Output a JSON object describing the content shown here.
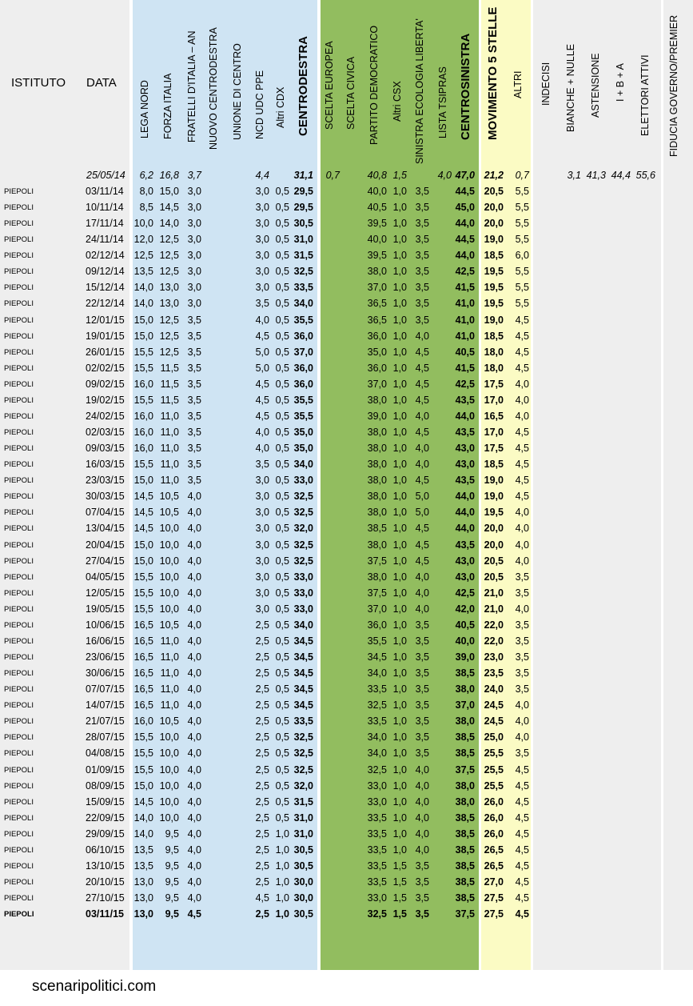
{
  "colors": {
    "grey_bg": "#eeeeee",
    "cdx_bg": "#cfe4f3",
    "csx_bg": "#92bd5f",
    "m5s_bg": "#fbfbc4",
    "white_gap": "#ffffff"
  },
  "headers": {
    "istituto": "ISTITUTO",
    "data": "DATA",
    "columns": [
      "LEGA NORD",
      "FORZA ITALIA",
      "FRATELLI D'ITALIA – AN",
      "NUOVO CENTRODESTRA",
      "UNIONE DI CENTRO",
      "NCD UDC PPE",
      "Altri CDX",
      "CENTRODESTRA",
      "SCELTA EUROPEA",
      "SCELTA CIVICA",
      "PARTITO DEMOCRATICO",
      "Altri CSX",
      "SINISTRA ECOLOGIA LIBERTA'",
      "LISTA TSIPRAS",
      "CENTROSINISTRA",
      "MOVIMENTO 5 STELLE",
      "ALTRI",
      "INDECISI",
      "BIANCHE + NULLE",
      "ASTENSIONE",
      "I + B + A",
      "ELETTORI ATTIVI",
      "FIDUCIA GOVERNO/PREMIER"
    ]
  },
  "reference_row": {
    "date": "25/05/14",
    "values": [
      "6,2",
      "16,8",
      "3,7",
      "",
      "",
      "4,4",
      "",
      "31,1",
      "0,7",
      "",
      "40,8",
      "1,5",
      "",
      "4,0",
      "47,0",
      "21,2",
      "0,7",
      "",
      "3,1",
      "41,3",
      "44,4",
      "55,6",
      ""
    ]
  },
  "rows": [
    {
      "istituto": "PIEPOLI",
      "date": "03/11/14",
      "lega": "8,0",
      "fi": "15,0",
      "fdi": "3,0",
      "ncd": "3,0",
      "acdx": "0,5",
      "cdx": "29,5",
      "pd": "40,0",
      "acsx": "1,0",
      "sel": "3,5",
      "csx": "44,5",
      "m5s": "20,5",
      "altri": "5,5"
    },
    {
      "istituto": "PIEPOLI",
      "date": "10/11/14",
      "lega": "8,5",
      "fi": "14,5",
      "fdi": "3,0",
      "ncd": "3,0",
      "acdx": "0,5",
      "cdx": "29,5",
      "pd": "40,5",
      "acsx": "1,0",
      "sel": "3,5",
      "csx": "45,0",
      "m5s": "20,0",
      "altri": "5,5"
    },
    {
      "istituto": "PIEPOLI",
      "date": "17/11/14",
      "lega": "10,0",
      "fi": "14,0",
      "fdi": "3,0",
      "ncd": "3,0",
      "acdx": "0,5",
      "cdx": "30,5",
      "pd": "39,5",
      "acsx": "1,0",
      "sel": "3,5",
      "csx": "44,0",
      "m5s": "20,0",
      "altri": "5,5"
    },
    {
      "istituto": "PIEPOLI",
      "date": "24/11/14",
      "lega": "12,0",
      "fi": "12,5",
      "fdi": "3,0",
      "ncd": "3,0",
      "acdx": "0,5",
      "cdx": "31,0",
      "pd": "40,0",
      "acsx": "1,0",
      "sel": "3,5",
      "csx": "44,5",
      "m5s": "19,0",
      "altri": "5,5"
    },
    {
      "istituto": "PIEPOLI",
      "date": "02/12/14",
      "lega": "12,5",
      "fi": "12,5",
      "fdi": "3,0",
      "ncd": "3,0",
      "acdx": "0,5",
      "cdx": "31,5",
      "pd": "39,5",
      "acsx": "1,0",
      "sel": "3,5",
      "csx": "44,0",
      "m5s": "18,5",
      "altri": "6,0"
    },
    {
      "istituto": "PIEPOLI",
      "date": "09/12/14",
      "lega": "13,5",
      "fi": "12,5",
      "fdi": "3,0",
      "ncd": "3,0",
      "acdx": "0,5",
      "cdx": "32,5",
      "pd": "38,0",
      "acsx": "1,0",
      "sel": "3,5",
      "csx": "42,5",
      "m5s": "19,5",
      "altri": "5,5"
    },
    {
      "istituto": "PIEPOLI",
      "date": "15/12/14",
      "lega": "14,0",
      "fi": "13,0",
      "fdi": "3,0",
      "ncd": "3,0",
      "acdx": "0,5",
      "cdx": "33,5",
      "pd": "37,0",
      "acsx": "1,0",
      "sel": "3,5",
      "csx": "41,5",
      "m5s": "19,5",
      "altri": "5,5"
    },
    {
      "istituto": "PIEPOLI",
      "date": "22/12/14",
      "lega": "14,0",
      "fi": "13,0",
      "fdi": "3,0",
      "ncd": "3,5",
      "acdx": "0,5",
      "cdx": "34,0",
      "pd": "36,5",
      "acsx": "1,0",
      "sel": "3,5",
      "csx": "41,0",
      "m5s": "19,5",
      "altri": "5,5"
    },
    {
      "istituto": "PIEPOLI",
      "date": "12/01/15",
      "lega": "15,0",
      "fi": "12,5",
      "fdi": "3,5",
      "ncd": "4,0",
      "acdx": "0,5",
      "cdx": "35,5",
      "pd": "36,5",
      "acsx": "1,0",
      "sel": "3,5",
      "csx": "41,0",
      "m5s": "19,0",
      "altri": "4,5"
    },
    {
      "istituto": "PIEPOLI",
      "date": "19/01/15",
      "lega": "15,0",
      "fi": "12,5",
      "fdi": "3,5",
      "ncd": "4,5",
      "acdx": "0,5",
      "cdx": "36,0",
      "pd": "36,0",
      "acsx": "1,0",
      "sel": "4,0",
      "csx": "41,0",
      "m5s": "18,5",
      "altri": "4,5"
    },
    {
      "istituto": "PIEPOLI",
      "date": "26/01/15",
      "lega": "15,5",
      "fi": "12,5",
      "fdi": "3,5",
      "ncd": "5,0",
      "acdx": "0,5",
      "cdx": "37,0",
      "pd": "35,0",
      "acsx": "1,0",
      "sel": "4,5",
      "csx": "40,5",
      "m5s": "18,0",
      "altri": "4,5"
    },
    {
      "istituto": "PIEPOLI",
      "date": "02/02/15",
      "lega": "15,5",
      "fi": "11,5",
      "fdi": "3,5",
      "ncd": "5,0",
      "acdx": "0,5",
      "cdx": "36,0",
      "pd": "36,0",
      "acsx": "1,0",
      "sel": "4,5",
      "csx": "41,5",
      "m5s": "18,0",
      "altri": "4,5"
    },
    {
      "istituto": "PIEPOLI",
      "date": "09/02/15",
      "lega": "16,0",
      "fi": "11,5",
      "fdi": "3,5",
      "ncd": "4,5",
      "acdx": "0,5",
      "cdx": "36,0",
      "pd": "37,0",
      "acsx": "1,0",
      "sel": "4,5",
      "csx": "42,5",
      "m5s": "17,5",
      "altri": "4,0"
    },
    {
      "istituto": "PIEPOLI",
      "date": "19/02/15",
      "lega": "15,5",
      "fi": "11,5",
      "fdi": "3,5",
      "ncd": "4,5",
      "acdx": "0,5",
      "cdx": "35,5",
      "pd": "38,0",
      "acsx": "1,0",
      "sel": "4,5",
      "csx": "43,5",
      "m5s": "17,0",
      "altri": "4,0"
    },
    {
      "istituto": "PIEPOLI",
      "date": "24/02/15",
      "lega": "16,0",
      "fi": "11,0",
      "fdi": "3,5",
      "ncd": "4,5",
      "acdx": "0,5",
      "cdx": "35,5",
      "pd": "39,0",
      "acsx": "1,0",
      "sel": "4,0",
      "csx": "44,0",
      "m5s": "16,5",
      "altri": "4,0"
    },
    {
      "istituto": "PIEPOLI",
      "date": "02/03/15",
      "lega": "16,0",
      "fi": "11,0",
      "fdi": "3,5",
      "ncd": "4,0",
      "acdx": "0,5",
      "cdx": "35,0",
      "pd": "38,0",
      "acsx": "1,0",
      "sel": "4,5",
      "csx": "43,5",
      "m5s": "17,0",
      "altri": "4,5"
    },
    {
      "istituto": "PIEPOLI",
      "date": "09/03/15",
      "lega": "16,0",
      "fi": "11,0",
      "fdi": "3,5",
      "ncd": "4,0",
      "acdx": "0,5",
      "cdx": "35,0",
      "pd": "38,0",
      "acsx": "1,0",
      "sel": "4,0",
      "csx": "43,0",
      "m5s": "17,5",
      "altri": "4,5"
    },
    {
      "istituto": "PIEPOLI",
      "date": "16/03/15",
      "lega": "15,5",
      "fi": "11,0",
      "fdi": "3,5",
      "ncd": "3,5",
      "acdx": "0,5",
      "cdx": "34,0",
      "pd": "38,0",
      "acsx": "1,0",
      "sel": "4,0",
      "csx": "43,0",
      "m5s": "18,5",
      "altri": "4,5"
    },
    {
      "istituto": "PIEPOLI",
      "date": "23/03/15",
      "lega": "15,0",
      "fi": "11,0",
      "fdi": "3,5",
      "ncd": "3,0",
      "acdx": "0,5",
      "cdx": "33,0",
      "pd": "38,0",
      "acsx": "1,0",
      "sel": "4,5",
      "csx": "43,5",
      "m5s": "19,0",
      "altri": "4,5"
    },
    {
      "istituto": "PIEPOLI",
      "date": "30/03/15",
      "lega": "14,5",
      "fi": "10,5",
      "fdi": "4,0",
      "ncd": "3,0",
      "acdx": "0,5",
      "cdx": "32,5",
      "pd": "38,0",
      "acsx": "1,0",
      "sel": "5,0",
      "csx": "44,0",
      "m5s": "19,0",
      "altri": "4,5"
    },
    {
      "istituto": "PIEPOLI",
      "date": "07/04/15",
      "lega": "14,5",
      "fi": "10,5",
      "fdi": "4,0",
      "ncd": "3,0",
      "acdx": "0,5",
      "cdx": "32,5",
      "pd": "38,0",
      "acsx": "1,0",
      "sel": "5,0",
      "csx": "44,0",
      "m5s": "19,5",
      "altri": "4,0"
    },
    {
      "istituto": "PIEPOLI",
      "date": "13/04/15",
      "lega": "14,5",
      "fi": "10,0",
      "fdi": "4,0",
      "ncd": "3,0",
      "acdx": "0,5",
      "cdx": "32,0",
      "pd": "38,5",
      "acsx": "1,0",
      "sel": "4,5",
      "csx": "44,0",
      "m5s": "20,0",
      "altri": "4,0"
    },
    {
      "istituto": "PIEPOLI",
      "date": "20/04/15",
      "lega": "15,0",
      "fi": "10,0",
      "fdi": "4,0",
      "ncd": "3,0",
      "acdx": "0,5",
      "cdx": "32,5",
      "pd": "38,0",
      "acsx": "1,0",
      "sel": "4,5",
      "csx": "43,5",
      "m5s": "20,0",
      "altri": "4,0"
    },
    {
      "istituto": "PIEPOLI",
      "date": "27/04/15",
      "lega": "15,0",
      "fi": "10,0",
      "fdi": "4,0",
      "ncd": "3,0",
      "acdx": "0,5",
      "cdx": "32,5",
      "pd": "37,5",
      "acsx": "1,0",
      "sel": "4,5",
      "csx": "43,0",
      "m5s": "20,5",
      "altri": "4,0"
    },
    {
      "istituto": "PIEPOLI",
      "date": "04/05/15",
      "lega": "15,5",
      "fi": "10,0",
      "fdi": "4,0",
      "ncd": "3,0",
      "acdx": "0,5",
      "cdx": "33,0",
      "pd": "38,0",
      "acsx": "1,0",
      "sel": "4,0",
      "csx": "43,0",
      "m5s": "20,5",
      "altri": "3,5"
    },
    {
      "istituto": "PIEPOLI",
      "date": "12/05/15",
      "lega": "15,5",
      "fi": "10,0",
      "fdi": "4,0",
      "ncd": "3,0",
      "acdx": "0,5",
      "cdx": "33,0",
      "pd": "37,5",
      "acsx": "1,0",
      "sel": "4,0",
      "csx": "42,5",
      "m5s": "21,0",
      "altri": "3,5"
    },
    {
      "istituto": "PIEPOLI",
      "date": "19/05/15",
      "lega": "15,5",
      "fi": "10,0",
      "fdi": "4,0",
      "ncd": "3,0",
      "acdx": "0,5",
      "cdx": "33,0",
      "pd": "37,0",
      "acsx": "1,0",
      "sel": "4,0",
      "csx": "42,0",
      "m5s": "21,0",
      "altri": "4,0"
    },
    {
      "istituto": "PIEPOLI",
      "date": "10/06/15",
      "lega": "16,5",
      "fi": "10,5",
      "fdi": "4,0",
      "ncd": "2,5",
      "acdx": "0,5",
      "cdx": "34,0",
      "pd": "36,0",
      "acsx": "1,0",
      "sel": "3,5",
      "csx": "40,5",
      "m5s": "22,0",
      "altri": "3,5"
    },
    {
      "istituto": "PIEPOLI",
      "date": "16/06/15",
      "lega": "16,5",
      "fi": "11,0",
      "fdi": "4,0",
      "ncd": "2,5",
      "acdx": "0,5",
      "cdx": "34,5",
      "pd": "35,5",
      "acsx": "1,0",
      "sel": "3,5",
      "csx": "40,0",
      "m5s": "22,0",
      "altri": "3,5"
    },
    {
      "istituto": "PIEPOLI",
      "date": "23/06/15",
      "lega": "16,5",
      "fi": "11,0",
      "fdi": "4,0",
      "ncd": "2,5",
      "acdx": "0,5",
      "cdx": "34,5",
      "pd": "34,5",
      "acsx": "1,0",
      "sel": "3,5",
      "csx": "39,0",
      "m5s": "23,0",
      "altri": "3,5"
    },
    {
      "istituto": "PIEPOLI",
      "date": "30/06/15",
      "lega": "16,5",
      "fi": "11,0",
      "fdi": "4,0",
      "ncd": "2,5",
      "acdx": "0,5",
      "cdx": "34,5",
      "pd": "34,0",
      "acsx": "1,0",
      "sel": "3,5",
      "csx": "38,5",
      "m5s": "23,5",
      "altri": "3,5"
    },
    {
      "istituto": "PIEPOLI",
      "date": "07/07/15",
      "lega": "16,5",
      "fi": "11,0",
      "fdi": "4,0",
      "ncd": "2,5",
      "acdx": "0,5",
      "cdx": "34,5",
      "pd": "33,5",
      "acsx": "1,0",
      "sel": "3,5",
      "csx": "38,0",
      "m5s": "24,0",
      "altri": "3,5"
    },
    {
      "istituto": "PIEPOLI",
      "date": "14/07/15",
      "lega": "16,5",
      "fi": "11,0",
      "fdi": "4,0",
      "ncd": "2,5",
      "acdx": "0,5",
      "cdx": "34,5",
      "pd": "32,5",
      "acsx": "1,0",
      "sel": "3,5",
      "csx": "37,0",
      "m5s": "24,5",
      "altri": "4,0"
    },
    {
      "istituto": "PIEPOLI",
      "date": "21/07/15",
      "lega": "16,0",
      "fi": "10,5",
      "fdi": "4,0",
      "ncd": "2,5",
      "acdx": "0,5",
      "cdx": "33,5",
      "pd": "33,5",
      "acsx": "1,0",
      "sel": "3,5",
      "csx": "38,0",
      "m5s": "24,5",
      "altri": "4,0"
    },
    {
      "istituto": "PIEPOLI",
      "date": "28/07/15",
      "lega": "15,5",
      "fi": "10,0",
      "fdi": "4,0",
      "ncd": "2,5",
      "acdx": "0,5",
      "cdx": "32,5",
      "pd": "34,0",
      "acsx": "1,0",
      "sel": "3,5",
      "csx": "38,5",
      "m5s": "25,0",
      "altri": "4,0"
    },
    {
      "istituto": "PIEPOLI",
      "date": "04/08/15",
      "lega": "15,5",
      "fi": "10,0",
      "fdi": "4,0",
      "ncd": "2,5",
      "acdx": "0,5",
      "cdx": "32,5",
      "pd": "34,0",
      "acsx": "1,0",
      "sel": "3,5",
      "csx": "38,5",
      "m5s": "25,5",
      "altri": "3,5"
    },
    {
      "istituto": "PIEPOLI",
      "date": "01/09/15",
      "lega": "15,5",
      "fi": "10,0",
      "fdi": "4,0",
      "ncd": "2,5",
      "acdx": "0,5",
      "cdx": "32,5",
      "pd": "32,5",
      "acsx": "1,0",
      "sel": "4,0",
      "csx": "37,5",
      "m5s": "25,5",
      "altri": "4,5"
    },
    {
      "istituto": "PIEPOLI",
      "date": "08/09/15",
      "lega": "15,0",
      "fi": "10,0",
      "fdi": "4,0",
      "ncd": "2,5",
      "acdx": "0,5",
      "cdx": "32,0",
      "pd": "33,0",
      "acsx": "1,0",
      "sel": "4,0",
      "csx": "38,0",
      "m5s": "25,5",
      "altri": "4,5"
    },
    {
      "istituto": "PIEPOLI",
      "date": "15/09/15",
      "lega": "14,5",
      "fi": "10,0",
      "fdi": "4,0",
      "ncd": "2,5",
      "acdx": "0,5",
      "cdx": "31,5",
      "pd": "33,0",
      "acsx": "1,0",
      "sel": "4,0",
      "csx": "38,0",
      "m5s": "26,0",
      "altri": "4,5"
    },
    {
      "istituto": "PIEPOLI",
      "date": "22/09/15",
      "lega": "14,0",
      "fi": "10,0",
      "fdi": "4,0",
      "ncd": "2,5",
      "acdx": "0,5",
      "cdx": "31,0",
      "pd": "33,5",
      "acsx": "1,0",
      "sel": "4,0",
      "csx": "38,5",
      "m5s": "26,0",
      "altri": "4,5"
    },
    {
      "istituto": "PIEPOLI",
      "date": "29/09/15",
      "lega": "14,0",
      "fi": "9,5",
      "fdi": "4,0",
      "ncd": "2,5",
      "acdx": "1,0",
      "cdx": "31,0",
      "pd": "33,5",
      "acsx": "1,0",
      "sel": "4,0",
      "csx": "38,5",
      "m5s": "26,0",
      "altri": "4,5"
    },
    {
      "istituto": "PIEPOLI",
      "date": "06/10/15",
      "lega": "13,5",
      "fi": "9,5",
      "fdi": "4,0",
      "ncd": "2,5",
      "acdx": "1,0",
      "cdx": "30,5",
      "pd": "33,5",
      "acsx": "1,0",
      "sel": "4,0",
      "csx": "38,5",
      "m5s": "26,5",
      "altri": "4,5"
    },
    {
      "istituto": "PIEPOLI",
      "date": "13/10/15",
      "lega": "13,5",
      "fi": "9,5",
      "fdi": "4,0",
      "ncd": "2,5",
      "acdx": "1,0",
      "cdx": "30,5",
      "pd": "33,5",
      "acsx": "1,5",
      "sel": "3,5",
      "csx": "38,5",
      "m5s": "26,5",
      "altri": "4,5"
    },
    {
      "istituto": "PIEPOLI",
      "date": "20/10/15",
      "lega": "13,0",
      "fi": "9,5",
      "fdi": "4,0",
      "ncd": "2,5",
      "acdx": "1,0",
      "cdx": "30,0",
      "pd": "33,5",
      "acsx": "1,5",
      "sel": "3,5",
      "csx": "38,5",
      "m5s": "27,0",
      "altri": "4,5"
    },
    {
      "istituto": "PIEPOLI",
      "date": "27/10/15",
      "lega": "13,0",
      "fi": "9,5",
      "fdi": "4,0",
      "ncd": "4,5",
      "acdx": "1,0",
      "cdx": "30,0",
      "pd": "33,0",
      "acsx": "1,5",
      "sel": "3,5",
      "csx": "38,5",
      "m5s": "27,5",
      "altri": "4,5"
    },
    {
      "istituto": "PIEPOLI",
      "date": "03/11/15",
      "lega": "13,0",
      "fi": "9,5",
      "fdi": "4,5",
      "ncd": "2,5",
      "acdx": "1,0",
      "cdx": "30,5",
      "pd": "32,5",
      "acsx": "1,5",
      "sel": "3,5",
      "csx": "37,5",
      "m5s": "27,5",
      "altri": "4,5",
      "last": true
    }
  ],
  "footer": "scenaripolitici.com"
}
